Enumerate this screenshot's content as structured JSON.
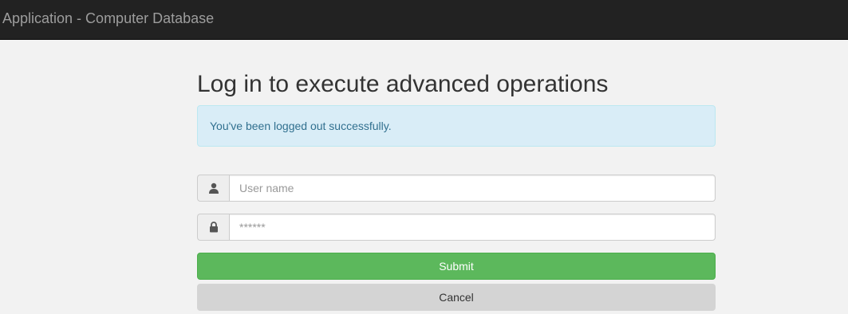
{
  "navbar": {
    "brand": "Application - Computer Database"
  },
  "page": {
    "title": "Log in to execute advanced operations"
  },
  "alert": {
    "message": "You've been logged out successfully."
  },
  "form": {
    "username": {
      "value": "",
      "placeholder": "User name",
      "icon": "user-icon"
    },
    "password": {
      "value": "",
      "placeholder": "******",
      "icon": "lock-icon"
    },
    "submit_label": "Submit",
    "cancel_label": "Cancel"
  },
  "colors": {
    "navbar_bg": "#222222",
    "page_bg": "#f2f2f2",
    "alert_bg": "#d9edf7",
    "alert_text": "#31708f",
    "submit_bg": "#5cb85c",
    "cancel_bg": "#d4d4d4"
  }
}
